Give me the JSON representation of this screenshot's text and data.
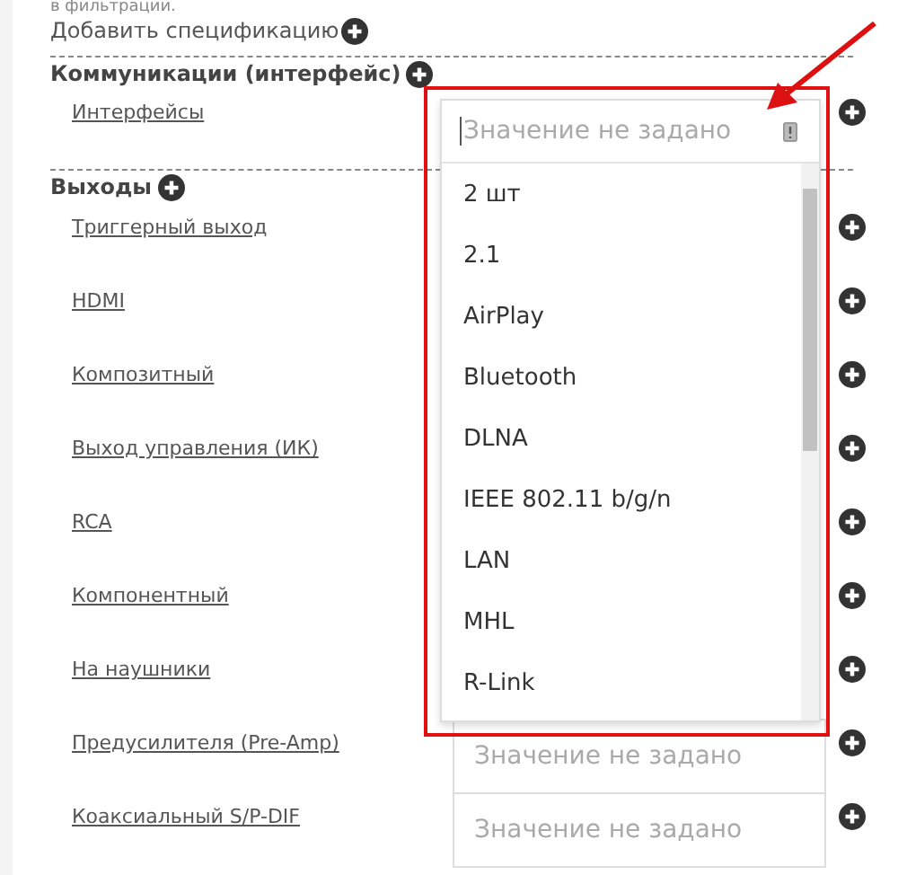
{
  "note": "в фильтрации.",
  "add_spec": {
    "label": "Добавить спецификацию"
  },
  "sections": [
    {
      "title": "Коммуникации (интерфейс)",
      "rows": [
        {
          "label": "Интерфейсы"
        }
      ]
    },
    {
      "title": "Выходы",
      "rows": [
        {
          "label": "Триггерный выход"
        },
        {
          "label": "HDMI"
        },
        {
          "label": "Композитный"
        },
        {
          "label": "Выход управления (ИК)"
        },
        {
          "label": "RCA"
        },
        {
          "label": "Компонентный"
        },
        {
          "label": "На наушники"
        },
        {
          "label": "Предусилителя (Pre-Amp)",
          "field": {
            "placeholder": "Значение не задано"
          }
        },
        {
          "label": "Коаксиальный S/P-DIF",
          "field": {
            "placeholder": "Значение не задано"
          }
        }
      ]
    }
  ],
  "dropdown": {
    "placeholder": "Значение не задано",
    "highlighted": true,
    "options": [
      "2 шт",
      "2.1",
      "AirPlay",
      "Bluetooth",
      "DLNA",
      "IEEE 802.11 b/g/n",
      "LAN",
      "MHL",
      "R-Link"
    ]
  }
}
